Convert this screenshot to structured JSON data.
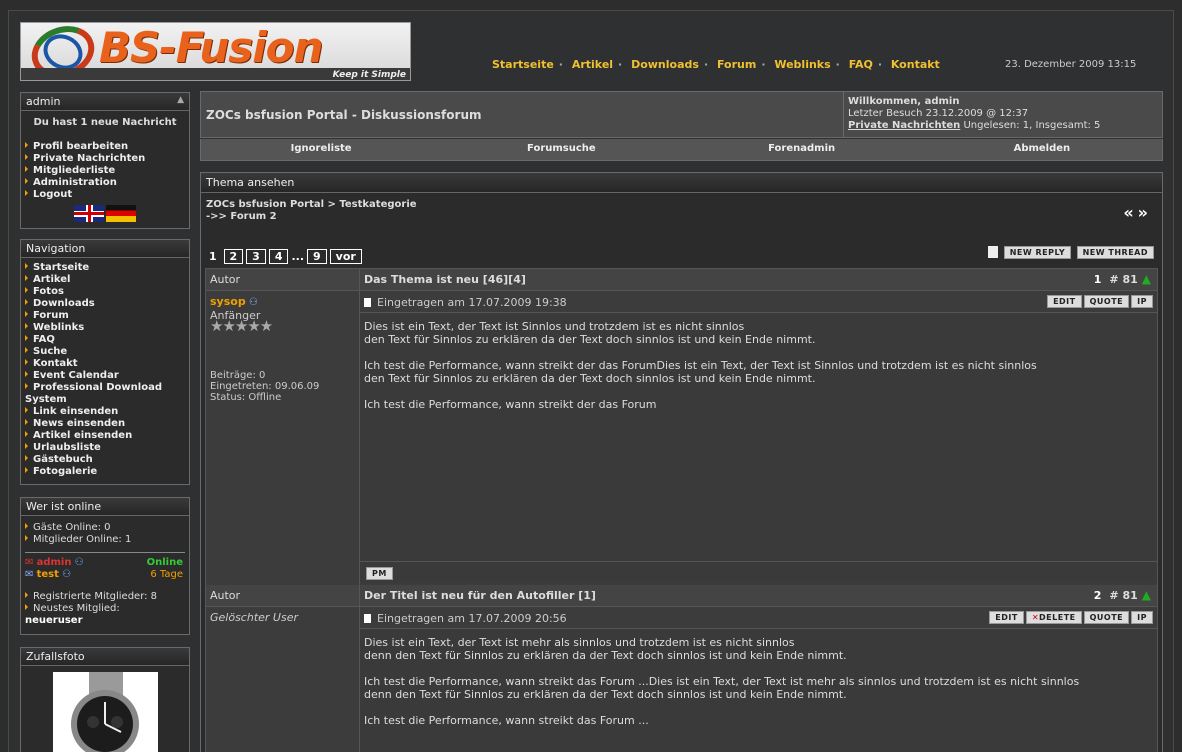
{
  "site": {
    "logo_text": "BS-Fusion",
    "logo_tagline": "Keep it Simple"
  },
  "topnav": [
    "Startseite",
    "Artikel",
    "Downloads",
    "Forum",
    "Weblinks",
    "FAQ",
    "Kontakt"
  ],
  "top_date": "23. Dezember 2009 13:15",
  "user_panel": {
    "title": "admin",
    "message": "Du hast 1 neue Nachricht",
    "links": [
      "Profil bearbeiten",
      "Private Nachrichten",
      "Mitgliederliste",
      "Administration",
      "Logout"
    ]
  },
  "navigation": {
    "title": "Navigation",
    "links": [
      "Startseite",
      "Artikel",
      "Fotos",
      "Downloads",
      "Forum",
      "Weblinks",
      "FAQ",
      "Suche",
      "Kontakt",
      "Event Calendar",
      "Professional Download System",
      "Link einsenden",
      "News einsenden",
      "Artikel einsenden",
      "Urlaubsliste",
      "Gästebuch",
      "Fotogalerie"
    ]
  },
  "online": {
    "title": "Wer ist online",
    "guests": "Gäste Online: 0",
    "members": "Mitglieder Online: 1",
    "user1": "admin",
    "user1_status": "Online",
    "user2": "test",
    "user2_status": "6 Tage",
    "registered": "Registrierte Mitglieder: 8",
    "newest_label": "Neustes Mitglied:",
    "newest": "neueruser"
  },
  "random_photo": {
    "title": "Zufallsfoto"
  },
  "forum_header": {
    "title": "ZOCs bsfusion Portal - Diskussionsforum",
    "welcome": "Willkommen, admin",
    "last_visit": "Letzter Besuch 23.12.2009 @ 12:37",
    "pm_link": "Private Nachrichten",
    "pm_stats": "Ungelesen: 1, Insgesamt: 5"
  },
  "tabs": [
    "Ignoreliste",
    "Forumsuche",
    "Forenadmin",
    "Abmelden"
  ],
  "thread": {
    "box_title": "Thema ansehen",
    "crumb_line1": "ZOCs bsfusion Portal > Testkategorie",
    "crumb_line2": "->> Forum 2",
    "current_page": "1",
    "pages": [
      "2",
      "3",
      "4"
    ],
    "ellipsis": "...",
    "last_page": "9",
    "next": "vor",
    "new_reply": "NEW REPLY",
    "new_thread": "NEW THREAD"
  },
  "posts": [
    {
      "author_label": "Autor",
      "title": "Das Thema ist neu [46][4]",
      "num": "1",
      "hash": "# 81",
      "author": "sysop",
      "rank": "Anfänger",
      "posts": "Beiträge: 0",
      "joined": "Eingetreten: 09.06.09",
      "status": "Status: Offline",
      "date": "Eingetragen am 17.07.2009 19:38",
      "lines": [
        "Dies ist ein Text, der Text ist Sinnlos und trotzdem ist es nicht sinnlos",
        "den Text für Sinnlos zu erklären da der Text doch sinnlos ist und kein Ende nimmt.",
        "",
        "Ich test die Performance, wann streikt der das ForumDies ist ein Text, der Text ist Sinnlos und trotzdem ist es nicht sinnlos",
        "den Text für Sinnlos zu erklären da der Text doch sinnlos ist und kein Ende nimmt.",
        "",
        "Ich test die Performance, wann streikt der das Forum"
      ],
      "pm": "PM"
    },
    {
      "author_label": "Autor",
      "title": "Der Titel ist neu für den Autofiller [1]",
      "num": "2",
      "hash": "# 81",
      "author": "Gelöschter User",
      "date": "Eingetragen am 17.07.2009 20:56",
      "lines": [
        "Dies ist ein Text, der Text ist mehr als sinnlos und trotzdem ist es nicht sinnlos",
        "denn den Text für Sinnlos zu erklären da der Text doch sinnlos ist und kein Ende nimmt.",
        "",
        "Ich test die Performance, wann streikt das Forum ...Dies ist ein Text, der Text ist mehr als sinnlos und trotzdem ist es nicht sinnlos",
        "denn den Text für Sinnlos zu erklären da der Text doch sinnlos ist und kein Ende nimmt.",
        "",
        "Ich test die Performance, wann streikt das Forum ..."
      ]
    }
  ],
  "tools": {
    "edit": "EDIT",
    "quote": "QUOTE",
    "ip": "IP",
    "delete": "DELETE"
  }
}
